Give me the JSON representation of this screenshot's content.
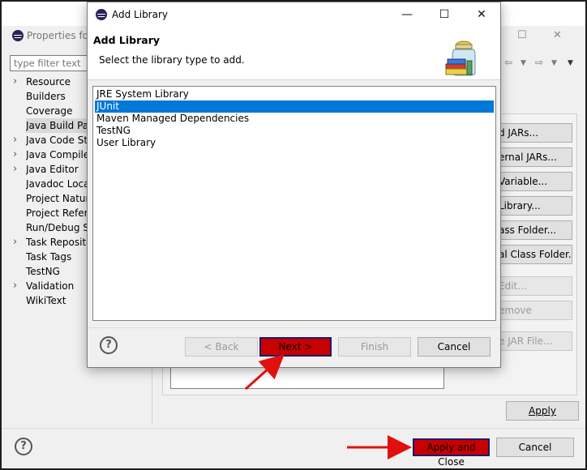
{
  "background_window": {
    "title": "Properties for",
    "filter_placeholder": "type filter text",
    "tree": [
      {
        "label": "Resource",
        "expandable": true
      },
      {
        "label": "Builders",
        "expandable": false
      },
      {
        "label": "Coverage",
        "expandable": false
      },
      {
        "label": "Java Build Path",
        "expandable": false,
        "selected": true
      },
      {
        "label": "Java Code Style",
        "expandable": true
      },
      {
        "label": "Java Compiler",
        "expandable": true
      },
      {
        "label": "Java Editor",
        "expandable": true
      },
      {
        "label": "Javadoc Location",
        "expandable": false
      },
      {
        "label": "Project Natures",
        "expandable": false
      },
      {
        "label": "Project References",
        "expandable": false
      },
      {
        "label": "Run/Debug Settings",
        "expandable": false
      },
      {
        "label": "Task Repository",
        "expandable": true
      },
      {
        "label": "Task Tags",
        "expandable": false
      },
      {
        "label": "TestNG",
        "expandable": false
      },
      {
        "label": "Validation",
        "expandable": true
      },
      {
        "label": "WikiText",
        "expandable": false
      }
    ],
    "side_buttons": [
      {
        "label": "d JARs...",
        "enabled": true
      },
      {
        "label": "ernal JARs...",
        "enabled": true
      },
      {
        "label": "Variable...",
        "enabled": true
      },
      {
        "label": "Library...",
        "enabled": true
      },
      {
        "label": "ass Folder...",
        "enabled": true
      },
      {
        "label": "al Class Folder...",
        "enabled": true
      },
      {
        "label": "Edit...",
        "enabled": false
      },
      {
        "label": "emove",
        "enabled": false
      },
      {
        "label": "e JAR File...",
        "enabled": false
      }
    ],
    "apply_label": "Apply",
    "apply_close_label": "Apply and Close",
    "cancel_label": "Cancel"
  },
  "dialog": {
    "title": "Add Library",
    "heading": "Add Library",
    "description": "Select the library type to add.",
    "library_types": [
      {
        "label": "JRE System Library",
        "selected": false
      },
      {
        "label": "JUnit",
        "selected": true
      },
      {
        "label": "Maven Managed Dependencies",
        "selected": false
      },
      {
        "label": "TestNG",
        "selected": false
      },
      {
        "label": "User Library",
        "selected": false
      }
    ],
    "buttons": {
      "back": "< Back",
      "next": "Next >",
      "finish": "Finish",
      "cancel": "Cancel"
    }
  },
  "colors": {
    "selection": "#0078d7",
    "highlight_red": "#c80000",
    "arrow_red": "#e01010"
  }
}
